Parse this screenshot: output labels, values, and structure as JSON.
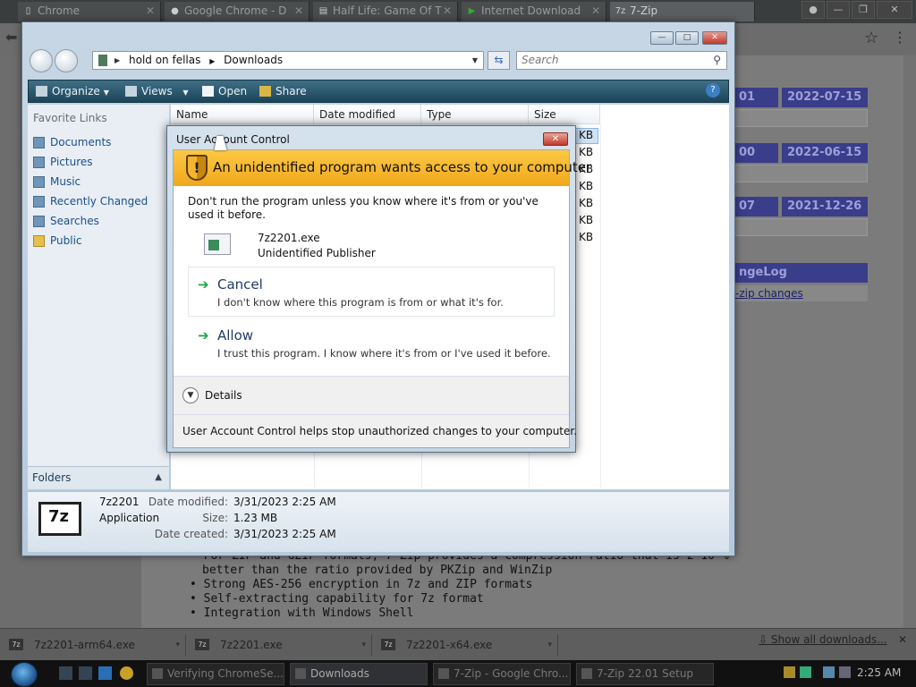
{
  "browser": {
    "tabs": [
      {
        "label": "Chrome",
        "icon": "page-icon"
      },
      {
        "label": "Google Chrome - D",
        "icon": "google-icon"
      },
      {
        "label": "Half Life: Game Of T",
        "icon": "page-icon"
      },
      {
        "label": "Internet Download",
        "icon": "play-icon"
      },
      {
        "label": "7-Zip",
        "icon": "7zip-icon",
        "active": true
      }
    ],
    "page": {
      "release_dates": [
        "2022-07-15",
        "2022-06-15",
        "2021-12-26"
      ],
      "release_fragments": [
        "01",
        "00",
        "07"
      ],
      "changelog_header": "ngeLog",
      "changelog_link": "-zip changes",
      "bullets": [
        "For ZIP and GZIP formats, 7-Zip provides a compression ratio that is 2-10 %",
        "better than the ratio provided by PKZip and WinZip",
        "Strong AES-256 encryption in 7z and ZIP formats",
        "Self-extracting capability for 7z format",
        "Integration with Windows Shell"
      ]
    },
    "downloads": {
      "items": [
        "7z2201-arm64.exe",
        "7z2201.exe",
        "7z2201-x64.exe"
      ],
      "show_all": "Show all downloads...",
      "close": "✕"
    }
  },
  "taskbar": {
    "buttons": [
      "Verifying ChromeSe...",
      "Downloads",
      "7-Zip - Google Chro...",
      "7-Zip 22.01 Setup"
    ],
    "clock": "2:25 AM"
  },
  "explorer": {
    "breadcrumb": [
      "hold on fellas",
      "Downloads"
    ],
    "search_placeholder": "Search",
    "commands": {
      "organize": "Organize",
      "views": "Views",
      "open": "Open",
      "share": "Share"
    },
    "favorites_header": "Favorite Links",
    "favorites": [
      "Documents",
      "Pictures",
      "Music",
      "Recently Changed",
      "Searches",
      "Public"
    ],
    "folders_label": "Folders",
    "columns": [
      "Name",
      "Date modified",
      "Type",
      "Size"
    ],
    "size_units": [
      "KB",
      "KB",
      "KB",
      "KB",
      "KB",
      "KB",
      "KB"
    ],
    "details": {
      "name": "7z2201",
      "type": "Application",
      "modified_label": "Date modified:",
      "modified_value": "3/31/2023 2:25 AM",
      "size_label": "Size:",
      "size_value": "1.23 MB",
      "created_label": "Date created:",
      "created_value": "3/31/2023 2:25 AM"
    }
  },
  "uac": {
    "title": "User Account Control",
    "banner": "An unidentified program wants access to your computer",
    "warning": "Don't run the program unless you know where it's from or you've used it before.",
    "program_name": "7z2201.exe",
    "publisher": "Unidentified Publisher",
    "cancel_title": "Cancel",
    "cancel_subtitle": "I don't know where this program is from or what it's for.",
    "allow_title": "Allow",
    "allow_subtitle": "I trust this program. I know where it's from or I've used it before.",
    "details_label": "Details",
    "footer": "User Account Control helps stop unauthorized changes to your computer."
  },
  "colors": {
    "banner": "#f7b52c",
    "command_bar": "#2a5a70",
    "accent_link": "#1b4f8a"
  }
}
